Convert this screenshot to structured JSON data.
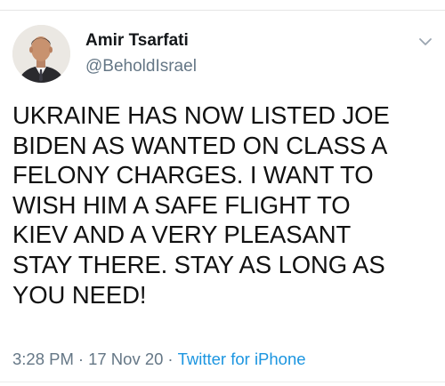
{
  "tweet": {
    "author": {
      "display_name": "Amir Tsarfati",
      "handle": "@BeholdIsrael"
    },
    "text_lines": [
      "UKRAINE HAS NOW LISTED JOE",
      "BIDEN AS WANTED ON CLASS A",
      "FELONY CHARGES. I WANT TO",
      "WISH HIM A SAFE FLIGHT TO",
      "KIEV AND A VERY PLEASANT",
      "STAY THERE. STAY AS LONG AS",
      "YOU NEED!"
    ],
    "time": "3:28 PM",
    "separator": "·",
    "date": "17 Nov 20",
    "source": "Twitter for iPhone"
  },
  "icons": {
    "avatar": "profile-photo",
    "menu": "chevron-down-icon"
  },
  "colors": {
    "name": "#14171a",
    "secondary": "#657786",
    "link": "#1b95e0"
  }
}
